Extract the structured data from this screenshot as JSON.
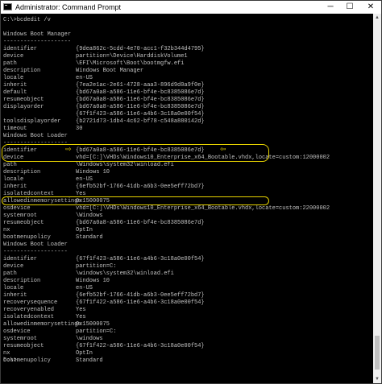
{
  "window": {
    "title": "Administrator: Command Prompt",
    "controls": {
      "minimize": "─",
      "maximize": "☐",
      "close": "✕"
    }
  },
  "colors": {
    "console_bg": "#000000",
    "console_text": "#c0c0c0",
    "highlight": "#e6d200"
  },
  "console": {
    "command": "C:\\>bcdedit /v",
    "section1_title": "Windows Boot Manager",
    "section1_sep": "--------------------",
    "section1": [
      {
        "key": "identifier",
        "value": "{9dea862c-5cdd-4e70-acc1-f32b344d4795}"
      },
      {
        "key": "device",
        "value": "partition=\\Device\\HarddiskVolume1"
      },
      {
        "key": "path",
        "value": "\\EFI\\Microsoft\\Boot\\bootmgfw.efi"
      },
      {
        "key": "description",
        "value": "Windows Boot Manager"
      },
      {
        "key": "locale",
        "value": "en-US"
      },
      {
        "key": "inherit",
        "value": "{7ea2e1ac-2e61-4728-aaa3-896d9d0a9f0e}"
      },
      {
        "key": "default",
        "value": "{bd67a0a8-a586-11e6-bf4e-bc8385086e7d}"
      },
      {
        "key": "resumeobject",
        "value": "{bd67a0a8-a586-11e6-bf4e-bc8385086e7d}"
      },
      {
        "key": "displayorder",
        "value": "{bd67a0a8-a586-11e6-bf4e-bc8385086e7d}"
      },
      {
        "key": "",
        "value": "{67f1f423-a586-11e6-a4b6-3c18a0e00f54}"
      },
      {
        "key": "toolsdisplayorder",
        "value": "{b2721d73-1db4-4c62-bf78-c548a880142d}"
      },
      {
        "key": "timeout",
        "value": "30"
      }
    ],
    "section2_title": "Windows Boot Loader",
    "section2_sep": "-------------------",
    "section2": [
      {
        "key": "identifier",
        "value": "{bd67a0a8-a586-11e6-bf4e-bc8385086e7d}"
      },
      {
        "key": "device",
        "value": "vhd=[C:]\\VHDs\\Windows10_Enterprise_x64_Bootable.vhdx,locate=custom:12000002"
      },
      {
        "key": "path",
        "value": "\\Windows\\system32\\winload.efi"
      },
      {
        "key": "description",
        "value": "Windows 10"
      },
      {
        "key": "locale",
        "value": "en-US"
      },
      {
        "key": "inherit",
        "value": "{6efb52bf-1766-41db-a6b3-0ee5eff72bd7}"
      },
      {
        "key": "isolatedcontext",
        "value": "Yes"
      },
      {
        "key": "allowedinmemorysettings",
        "value": "0x15000075"
      },
      {
        "key": "osdevice",
        "value": "vhd=[C:]\\VHDs\\Windows10_Enterprise_x64_Bootable.vhdx,locate=custom:22000002"
      },
      {
        "key": "systemroot",
        "value": "\\Windows"
      },
      {
        "key": "resumeobject",
        "value": "{bd67a0a8-a586-11e6-bf4e-bc8385086e7d}"
      },
      {
        "key": "nx",
        "value": "OptIn"
      },
      {
        "key": "bootmenupolicy",
        "value": "Standard"
      }
    ],
    "section3_title": "Windows Boot Loader",
    "section3_sep": "-------------------",
    "section3": [
      {
        "key": "identifier",
        "value": "{67f1f423-a586-11e6-a4b6-3c18a0e00f54}"
      },
      {
        "key": "device",
        "value": "partition=C:"
      },
      {
        "key": "path",
        "value": "\\windows\\system32\\winload.efi"
      },
      {
        "key": "description",
        "value": "Windows 10"
      },
      {
        "key": "locale",
        "value": "en-US"
      },
      {
        "key": "inherit",
        "value": "{6efb52bf-1766-41db-a6b3-0ee5eff72bd7}"
      },
      {
        "key": "recoverysequence",
        "value": "{67f1f422-a586-11e6-a4b6-3c18a0e00f54}"
      },
      {
        "key": "recoveryenabled",
        "value": "Yes"
      },
      {
        "key": "isolatedcontext",
        "value": "Yes"
      },
      {
        "key": "allowedinmemorysettings",
        "value": "0x15000075"
      },
      {
        "key": "osdevice",
        "value": "partition=C:"
      },
      {
        "key": "systemroot",
        "value": "\\windows"
      },
      {
        "key": "resumeobject",
        "value": "{67f1f422-a586-11e6-a4b6-3c18a0e00f54}"
      },
      {
        "key": "nx",
        "value": "OptIn"
      },
      {
        "key": "bootmenupolicy",
        "value": "Standard"
      }
    ],
    "prompt": "C:\\>",
    "arrow_left": "⇨",
    "arrow_right": "⇦"
  }
}
